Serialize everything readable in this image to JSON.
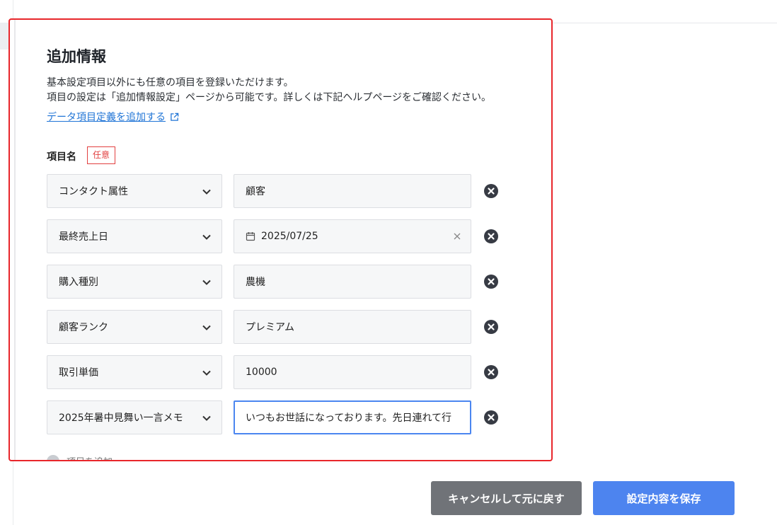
{
  "section": {
    "title": "追加情報",
    "description_line1": "基本設定項目以外にも任意の項目を登録いただけます。",
    "description_line2": "項目の設定は「追加情報設定」ページから可能です。詳しくは下記ヘルプページをご確認ください。",
    "help_link": "データ項目定義を追加する"
  },
  "field": {
    "label": "項目名",
    "badge": "任意"
  },
  "rows": [
    {
      "item": "コンタクト属性",
      "value": "顧客"
    },
    {
      "item": "最終売上日",
      "value": "2025/07/25"
    },
    {
      "item": "購入種別",
      "value": "農機"
    },
    {
      "item": "顧客ランク",
      "value": "プレミアム"
    },
    {
      "item": "取引単価",
      "value": "10000"
    },
    {
      "item": "2025年暑中見舞い一言メモ",
      "value": "いつもお世話になっております。先日連れて行"
    }
  ],
  "add_hint": "項目を追加",
  "buttons": {
    "cancel": "キャンセルして元に戻す",
    "save": "設定内容を保存"
  },
  "colors": {
    "highlight_border": "#e8262b",
    "link": "#1f74d6",
    "save_button": "#4d84ef",
    "cancel_button": "#707378",
    "focus_border": "#4b86f0"
  }
}
